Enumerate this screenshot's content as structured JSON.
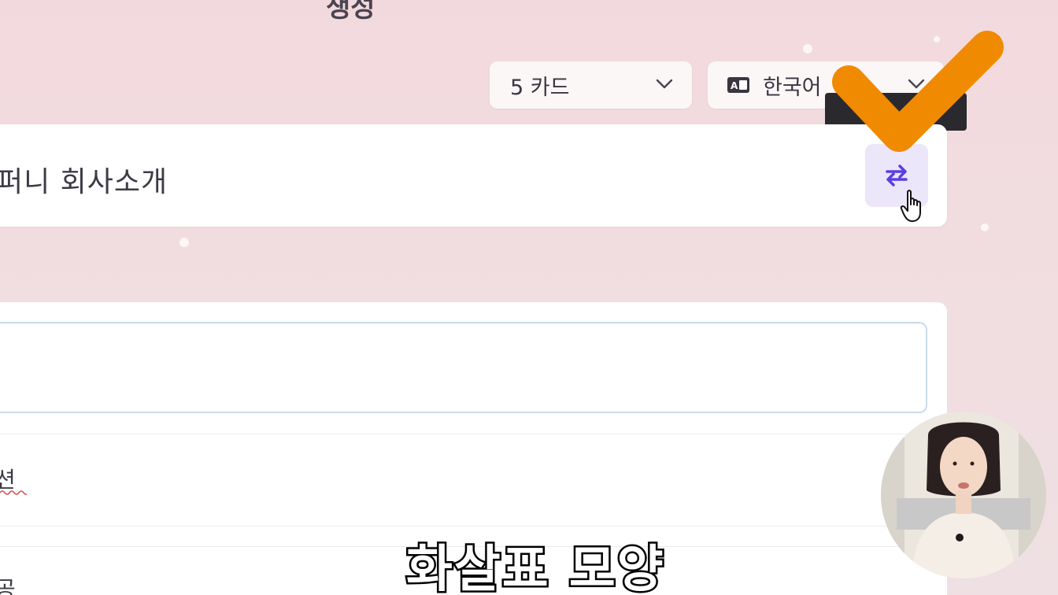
{
  "header": {
    "title": "생성"
  },
  "controls": {
    "card_count": "5 카드",
    "language": "한국어",
    "language_icon": "translate-icon",
    "chevron_icon": "chevron-down-icon"
  },
  "tooltip": {
    "text": ""
  },
  "prompt": {
    "text": "퍼니 회사소개",
    "swap_icon": "swap-arrows-icon",
    "accent_color": "#5b3fe0",
    "button_bg": "#ece6fb"
  },
  "outline": {
    "rows": [
      {
        "text": "션"
      },
      {
        "text": "공"
      }
    ]
  },
  "overlay": {
    "subtitle": "화살표 모양",
    "check_color": "#f08a00",
    "check_icon": "checkmark-icon",
    "cursor_icon": "hand-pointer-icon",
    "presenter": "presenter-video"
  }
}
